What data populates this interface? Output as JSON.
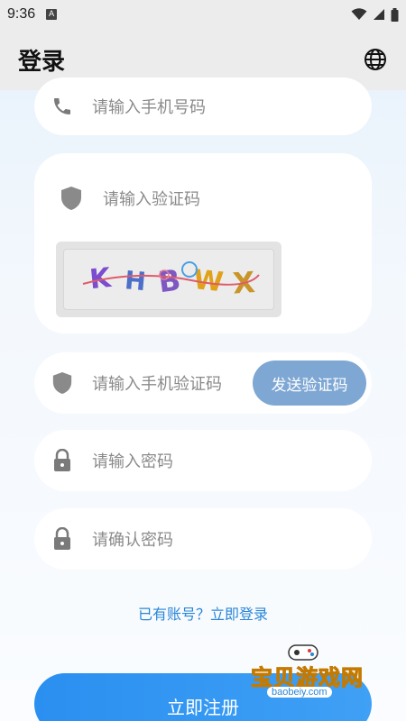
{
  "status_bar": {
    "time": "9:36",
    "notification_icon_letter": "A"
  },
  "app_bar": {
    "title": "登录"
  },
  "form": {
    "phone_placeholder": "请输入手机号码",
    "captcha_placeholder": "请输入验证码",
    "captcha_image_text": "KHBWX",
    "sms_code_placeholder": "请输入手机验证码",
    "send_code_label": "发送验证码",
    "password_placeholder": "请输入密码",
    "confirm_password_placeholder": "请确认密码"
  },
  "login_link": "已有账号？立即登录",
  "register_label": "立即注册",
  "watermark": {
    "text": "宝贝游戏网",
    "url": "baobeiy.com"
  }
}
